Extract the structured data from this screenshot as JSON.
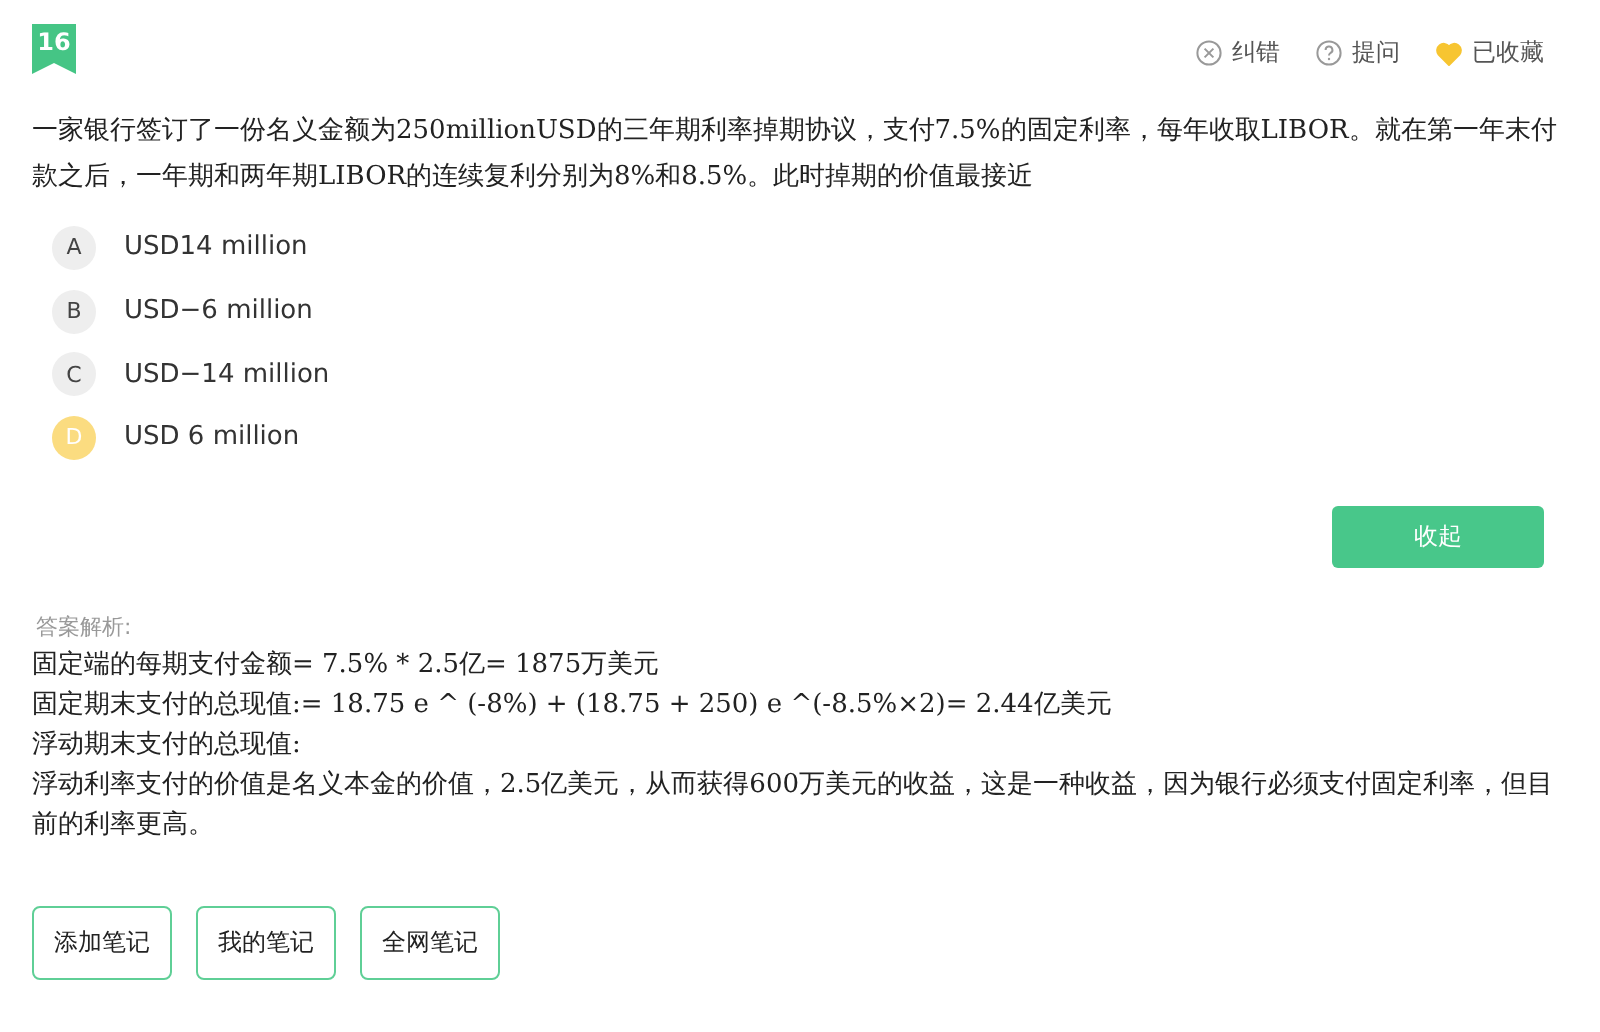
{
  "question": {
    "number": "16",
    "text": "一家银行签订了一份名义金额为250millionUSD的三年期利率掉期协议，支付7.5%的固定利率，每年收取LIBOR。就在第一年末付款之后，一年期和两年期LIBOR的连续复利分别为8%和8.5%。此时掉期的价值最接近"
  },
  "actions": [
    {
      "kind": "report",
      "label": "纠错"
    },
    {
      "kind": "ask",
      "label": "提问"
    },
    {
      "kind": "favorite",
      "label": "已收藏",
      "on": true
    }
  ],
  "options": [
    {
      "letter": "A",
      "text": "USD14 million",
      "selected": false
    },
    {
      "letter": "B",
      "text": "USD−6 million",
      "selected": false
    },
    {
      "letter": "C",
      "text": "USD−14 million",
      "selected": false
    },
    {
      "letter": "D",
      "text": "USD 6 million",
      "selected": true
    }
  ],
  "collapse_button": "收起",
  "analysis": {
    "label": "答案解析:",
    "lines": [
      "固定端的每期支付金额= 7.5% * 2.5亿= 1875万美元",
      "固定期末支付的总现值:= 18.75 e ^ (-8%) + (18.75 + 250) e ^(-8.5%×2)= 2.44亿美元",
      "浮动期末支付的总现值:",
      "浮动利率支付的价值是名义本金的价值，2.5亿美元，从而获得600万美元的收益，这是一种收益，因为银行必须支付固定利率，但目前的利率更高。"
    ]
  },
  "note_buttons": [
    "添加笔记",
    "我的笔记",
    "全网笔记"
  ]
}
